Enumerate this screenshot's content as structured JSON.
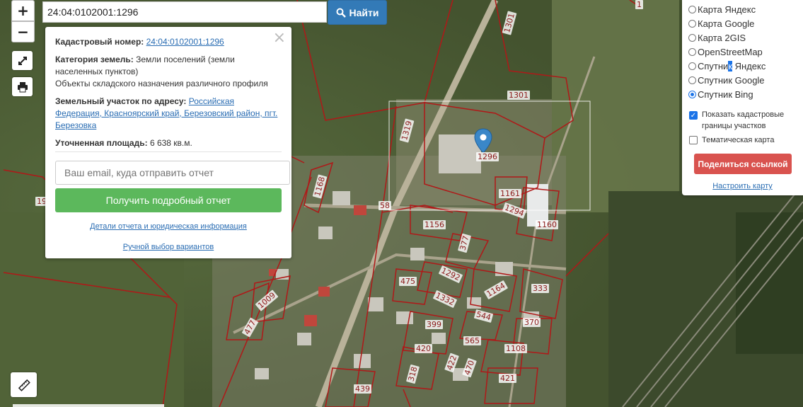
{
  "search": {
    "value": "24:04:0102001:1296",
    "button_label": "Найти"
  },
  "map_controls": {
    "zoom_in": "+",
    "zoom_out": "−"
  },
  "popup": {
    "close": "×",
    "cadastral_label": "Кадастровый номер:",
    "cadastral_number": "24:04:0102001:1296",
    "category_label": "Категория земель:",
    "category_value": "Земли поселений (земли населенных пунктов)",
    "usage": "Объекты складского назначения различного профиля",
    "address_label": "Земельный участок по адресу:",
    "address_value": "Российская Федерация, Красноярский край, Березовский район, пгт. Березовка",
    "area_label": "Уточненная площадь:",
    "area_value": "6 638 кв.м.",
    "email_placeholder": "Ваш email, куда отправить отчет",
    "report_button": "Получить подробный отчет",
    "details_link": "Детали отчета и юридическая информация",
    "manual_link": "Ручной выбор вариантов"
  },
  "layers": {
    "options": [
      {
        "label": "Карта Яндекс",
        "selected": false
      },
      {
        "label": "Карта Google",
        "selected": false
      },
      {
        "label": "Карта 2GIS",
        "selected": false
      },
      {
        "label": "OpenStreetMap",
        "selected": false
      },
      {
        "label_a": "Спутни",
        "label_hl": "к",
        "label_b": " Яндекс",
        "selected": false
      },
      {
        "label": "Спутник Google",
        "selected": false
      },
      {
        "label": "Спутник Bing",
        "selected": true
      }
    ],
    "show_cadastral": "Показать кадастровые границы участков",
    "show_cadastral_checked": true,
    "thematic": "Тематическая карта",
    "thematic_checked": false,
    "share_button": "Поделиться ссылкой",
    "setup_link": "Настроить карту"
  },
  "parcels": {
    "marker_label": "1296",
    "numbers": [
      "1301",
      "1301",
      "1319",
      "1168",
      "58",
      "1161",
      "1294",
      "1160",
      "1156",
      "377",
      "1292",
      "475",
      "1332",
      "1164",
      "333",
      "1009",
      "477",
      "399",
      "544",
      "370",
      "420",
      "565",
      "1108",
      "422",
      "470",
      "421",
      "439",
      "318",
      "19",
      "1"
    ]
  },
  "colors": {
    "parcel_border": "#b01818",
    "marker": "#3a87c8",
    "selection_box": "#ffffff"
  }
}
